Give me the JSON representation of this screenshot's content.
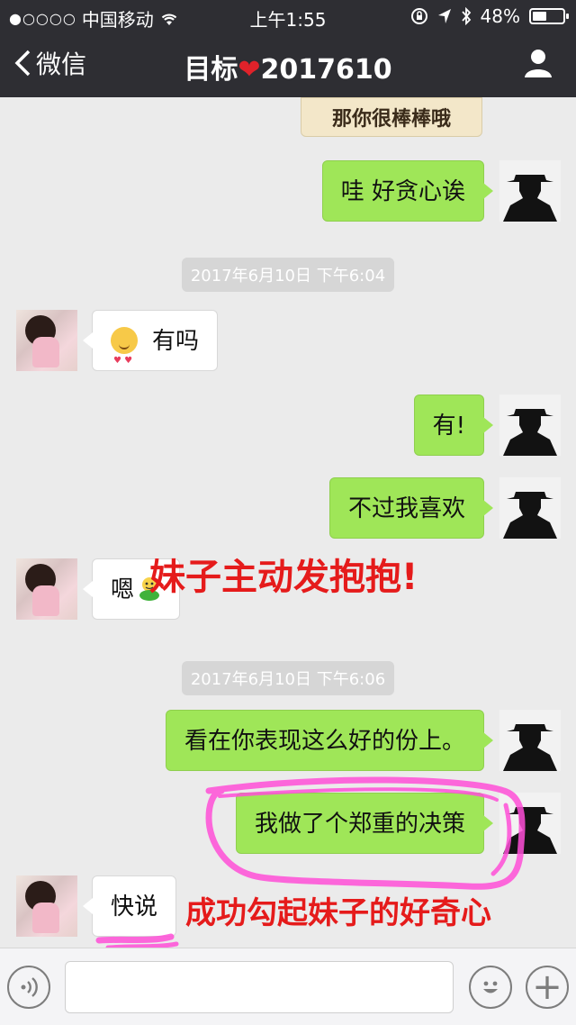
{
  "status_bar": {
    "signal": "●○○○○",
    "carrier": "中国移动",
    "time": "上午1:55",
    "battery": "48%",
    "battery_level": 0.48
  },
  "nav": {
    "back_label": "微信",
    "title_prefix": "目标",
    "title_heart": "❤",
    "title_suffix": "2017610",
    "profile_icon": "person-icon"
  },
  "sticker_text": "那你很棒棒哦",
  "messages": [
    {
      "side": "me",
      "text": "哇 好贪心诶"
    },
    {
      "type": "timestamp",
      "text": "2017年6月10日 下午6:04"
    },
    {
      "side": "them",
      "text": "有吗",
      "emoji": "heart-eyes-emoji"
    },
    {
      "side": "me",
      "text": "有!"
    },
    {
      "side": "me",
      "text": "不过我喜欢"
    },
    {
      "side": "them",
      "text": "嗯",
      "emoji": "frog-hug-emoji"
    },
    {
      "type": "timestamp",
      "text": "2017年6月10日 下午6:06"
    },
    {
      "side": "me",
      "text": "看在你表现这么好的份上。"
    },
    {
      "side": "me",
      "text": "我做了个郑重的决策"
    },
    {
      "side": "them",
      "text": "快说"
    }
  ],
  "annotations": {
    "hug": "妹子主动发抱抱!",
    "curiosity": "成功勾起妹子的好奇心"
  },
  "input_bar": {
    "voice_icon": "voice-icon",
    "emoji_icon": "emoji-icon",
    "plus_icon": "plus-icon",
    "plus_glyph": "+"
  },
  "colors": {
    "nav_bg": "#2e2e33",
    "chat_bg": "#ebebeb",
    "my_bubble": "#9fe658",
    "their_bubble": "#ffffff",
    "annotation": "#e51b1b",
    "highlighter": "#ff4fd8"
  }
}
